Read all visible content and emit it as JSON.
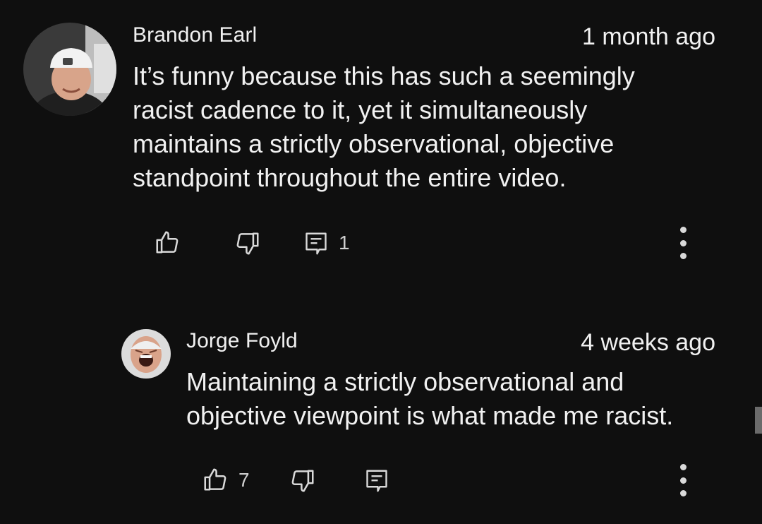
{
  "comments": [
    {
      "author": "Brandon Earl",
      "time": "1 month ago",
      "lines": [
        "It’s funny because this has such a seemingly",
        "racist cadence to it, yet it simultaneously",
        "maintains a strictly observational, objective",
        "standpoint throughout the entire video."
      ],
      "like_count": "",
      "reply_count": "1",
      "icons": {
        "like": "thumbs-up-icon",
        "dislike": "thumbs-down-icon",
        "reply": "reply-comment-icon",
        "more": "more-vertical-icon"
      }
    }
  ],
  "replies": [
    {
      "author": "Jorge Foyld",
      "time": "4 weeks ago",
      "lines": [
        "Maintaining a strictly observational and",
        "objective viewpoint is what made me racist."
      ],
      "like_count": "7",
      "reply_count": ""
    }
  ],
  "colors": {
    "background": "#0f0f0f",
    "text": "#f1f1f1",
    "icon": "#d9d9d9"
  }
}
